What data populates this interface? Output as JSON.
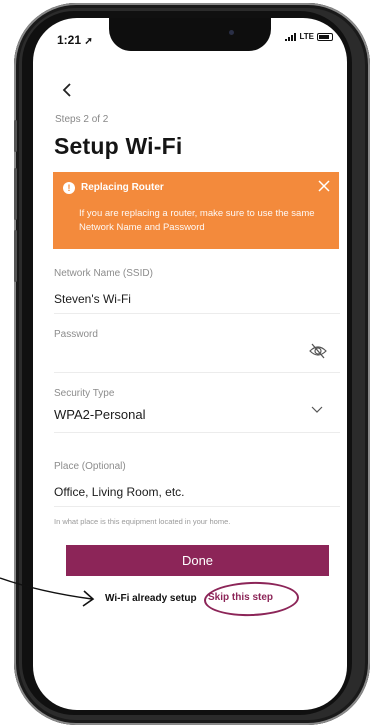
{
  "status_bar": {
    "time": "1:21",
    "network": "LTE"
  },
  "header": {
    "steps": "Steps 2 of 2",
    "title": "Setup Wi-Fi"
  },
  "alert": {
    "title": "Replacing Router",
    "body": "If you are replacing a router, make sure to use the same Network Name and Password",
    "color": "#f38a3c"
  },
  "form": {
    "ssid": {
      "label": "Network Name (SSID)",
      "value": "Steven's Wi-Fi"
    },
    "password": {
      "label": "Password",
      "value": ""
    },
    "security": {
      "label": "Security Type",
      "value": "WPA2-Personal"
    },
    "place": {
      "label": "Place (Optional)",
      "placeholder": "Office, Living Room, etc.",
      "hint": "In what place is this equipment located in your home."
    }
  },
  "actions": {
    "done_label": "Done",
    "already_label": "Wi-Fi already setup",
    "skip_label": "Skip this step",
    "accent": "#8c2558"
  }
}
